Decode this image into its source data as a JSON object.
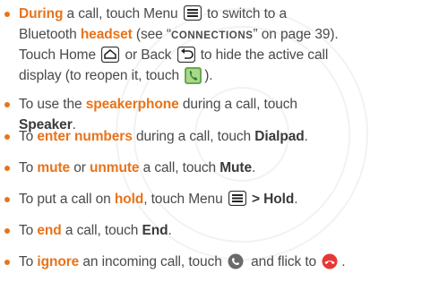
{
  "items": [
    {
      "l1a": "During",
      "l1b": " a call, touch Menu ",
      "l1c": " to switch to a",
      "l2a": "Bluetooth ",
      "l2b": "headset",
      "l2c": " (see “",
      "l2d": "CONNECTIONS",
      "l2e": "” on page 39).",
      "l3a": "Touch Home ",
      "l3b": " or Back ",
      "l3c": " to hide the active call",
      "l4a": "display (to reopen it, touch ",
      "l4b": ")."
    },
    {
      "l1a": "To use the ",
      "l1b": "speakerphone",
      "l1c": " during a call, touch",
      "l2a": "Speaker",
      "l2b": "."
    },
    {
      "a": "To ",
      "b": "enter numbers",
      "c": " during a call, touch ",
      "d": "Dialpad",
      "e": "."
    },
    {
      "a": "To ",
      "b": "mute",
      "c": " or ",
      "d": "unmute",
      "e": " a call, touch ",
      "f": "Mute",
      "g": "."
    },
    {
      "a": "To put a call on ",
      "b": "hold",
      "c": ", touch Menu ",
      "d": " > Hold",
      "e": "."
    },
    {
      "a": "To ",
      "b": "end",
      "c": " a call, touch ",
      "d": "End",
      "e": "."
    },
    {
      "a": "To ",
      "b": "ignore",
      "c": " an incoming call, touch ",
      "d": " and flick to ",
      "e": "."
    }
  ],
  "icons": {
    "menu": "menu-icon",
    "home": "home-icon",
    "back": "back-icon",
    "phone": "phone-app-icon",
    "answer": "answer-call-icon",
    "decline": "decline-call-icon"
  },
  "colors": {
    "accent": "#e8731a",
    "text": "#4a4a4a",
    "phone_green": "#4caf50",
    "decline_red": "#e53935"
  }
}
